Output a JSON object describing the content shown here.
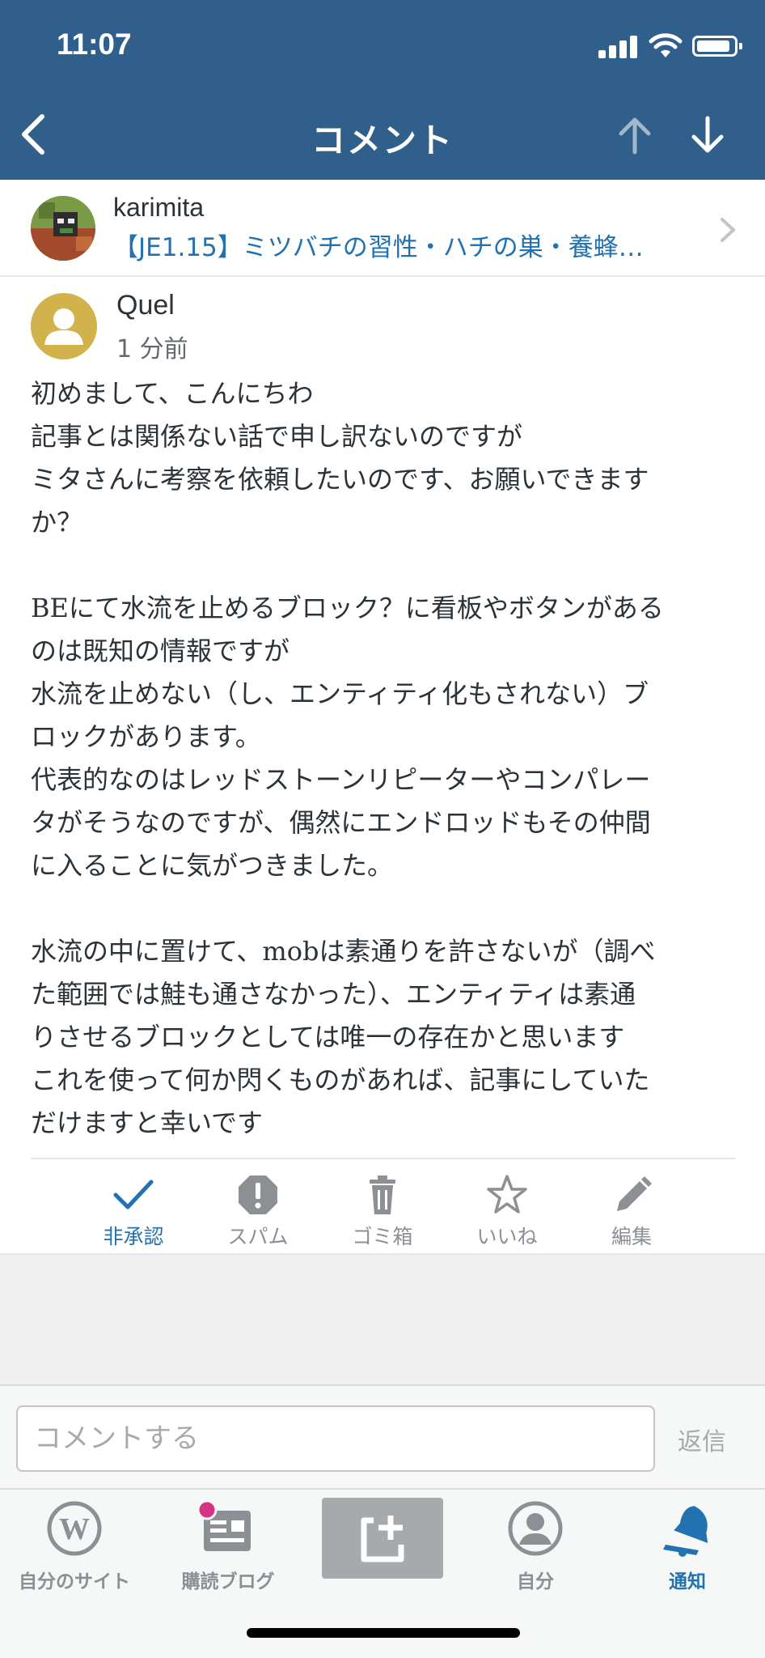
{
  "status_bar": {
    "time": "11:07"
  },
  "header": {
    "title": "コメント"
  },
  "post": {
    "author": "karimita",
    "title": "【JE1.15】ミツバチの習性・ハチの巣・養蜂…"
  },
  "comment": {
    "author": "Quel",
    "time": "1 分前",
    "lines": [
      "初めまして、こんにちわ",
      "記事とは関係ない話で申し訳ないのですが",
      "ミタさんに考察を依頼したいのです、お願いできます",
      "か？",
      "",
      "BEにて水流を止めるブロック？に看板やボタンがある",
      "のは既知の情報ですが",
      "水流を止めない（し、エンティティ化もされない）ブ",
      "ロックがあります。",
      "代表的なのはレッドストーンリピーターやコンパレー",
      "タがそうなのですが、偶然にエンドロッドもその仲間",
      "に入ることに気がつきました。",
      "",
      "水流の中に置けて、mobは素通りを許さないが（調べ",
      "た範囲では鮭も通さなかった）、エンティティは素通",
      "りさせるブロックとしては唯一の存在かと思います",
      "これを使って何か閃くものがあれば、記事にしていた",
      "だけますと幸いです"
    ]
  },
  "actions": [
    {
      "label": "非承認",
      "icon": "check-icon",
      "active": true
    },
    {
      "label": "スパム",
      "icon": "spam-icon",
      "active": false
    },
    {
      "label": "ゴミ箱",
      "icon": "trash-icon",
      "active": false
    },
    {
      "label": "いいね",
      "icon": "star-icon",
      "active": false
    },
    {
      "label": "編集",
      "icon": "pencil-icon",
      "active": false
    }
  ],
  "reply": {
    "placeholder": "コメントする",
    "button": "返信"
  },
  "tabs": [
    {
      "label": "自分のサイト",
      "icon": "wordpress-icon",
      "active": false
    },
    {
      "label": "購読ブログ",
      "icon": "reader-icon",
      "active": false
    },
    {
      "label": "",
      "icon": "new-post-icon",
      "active": false
    },
    {
      "label": "自分",
      "icon": "me-icon",
      "active": false
    },
    {
      "label": "通知",
      "icon": "bell-icon",
      "active": true
    }
  ],
  "colors": {
    "header_bg": "#2f5f8a",
    "link": "#2271b1",
    "muted": "#8c8f94",
    "avatar_bg": "#d1b24b",
    "badge": "#d63384"
  }
}
